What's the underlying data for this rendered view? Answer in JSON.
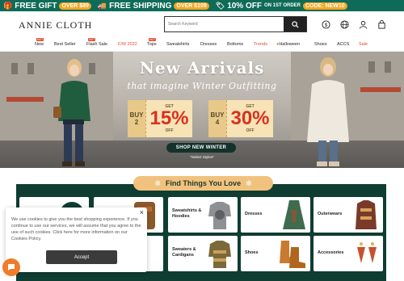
{
  "promo": {
    "item1": {
      "text": "FREE GIFT",
      "badge": "OVER $89",
      "icon": "gift-icon"
    },
    "item2": {
      "text": "FREE SHIPPING",
      "badge": "OVER $109",
      "icon": "truck-icon"
    },
    "item3": {
      "text": "10% OFF",
      "small": "ON 1ST ORDER",
      "code": "CODE: NEW10",
      "icon": "tag-icon"
    }
  },
  "header": {
    "logo": "ANNIE CLOTH",
    "search_placeholder": "Search Keyword"
  },
  "nav": {
    "items": [
      "New",
      "Best Seller",
      "Flash Sale",
      "F/W 2022",
      "Tops",
      "Sweatshirts",
      "Dresses",
      "Bottoms",
      "Trends",
      "Halloween",
      "Shoes",
      "ACCS",
      "Sale"
    ],
    "hot_label": "HOT"
  },
  "banner": {
    "title": "New Arrivals",
    "subtitle": "that imagine Winter Outfitting",
    "offer1": {
      "buy": [
        "BUY",
        "2"
      ],
      "get": "GET",
      "pct": "15%",
      "off": "OFF"
    },
    "offer2": {
      "buy": [
        "BUY",
        "4"
      ],
      "get": "GET",
      "pct": "30%",
      "off": "OFF"
    },
    "cta": "SHOP NEW WINTER",
    "note": "*Select Styles*"
  },
  "find": {
    "title": "Find Things You Love"
  },
  "categories": [
    {
      "label": "Sweatshirts & Hoodies"
    },
    {
      "label": "Dresses"
    },
    {
      "label": "Outerwears"
    },
    {
      "label": "Sweaters & Cardigans"
    },
    {
      "label": "Shoes"
    },
    {
      "label": "Accessories"
    }
  ],
  "cookie": {
    "text": "We use cookies to give you the best shopping experience. If you continue to use our services, we will assume that you agree to the use of such cookies. Click here for more information on our Cookies Policy.",
    "accept": "Accept",
    "close": "×"
  },
  "colors": {
    "brand_green": "#0f6b58",
    "accent_orange": "#f5a623",
    "sale_red": "#e8452c",
    "panel_green": "#0f3d31"
  }
}
